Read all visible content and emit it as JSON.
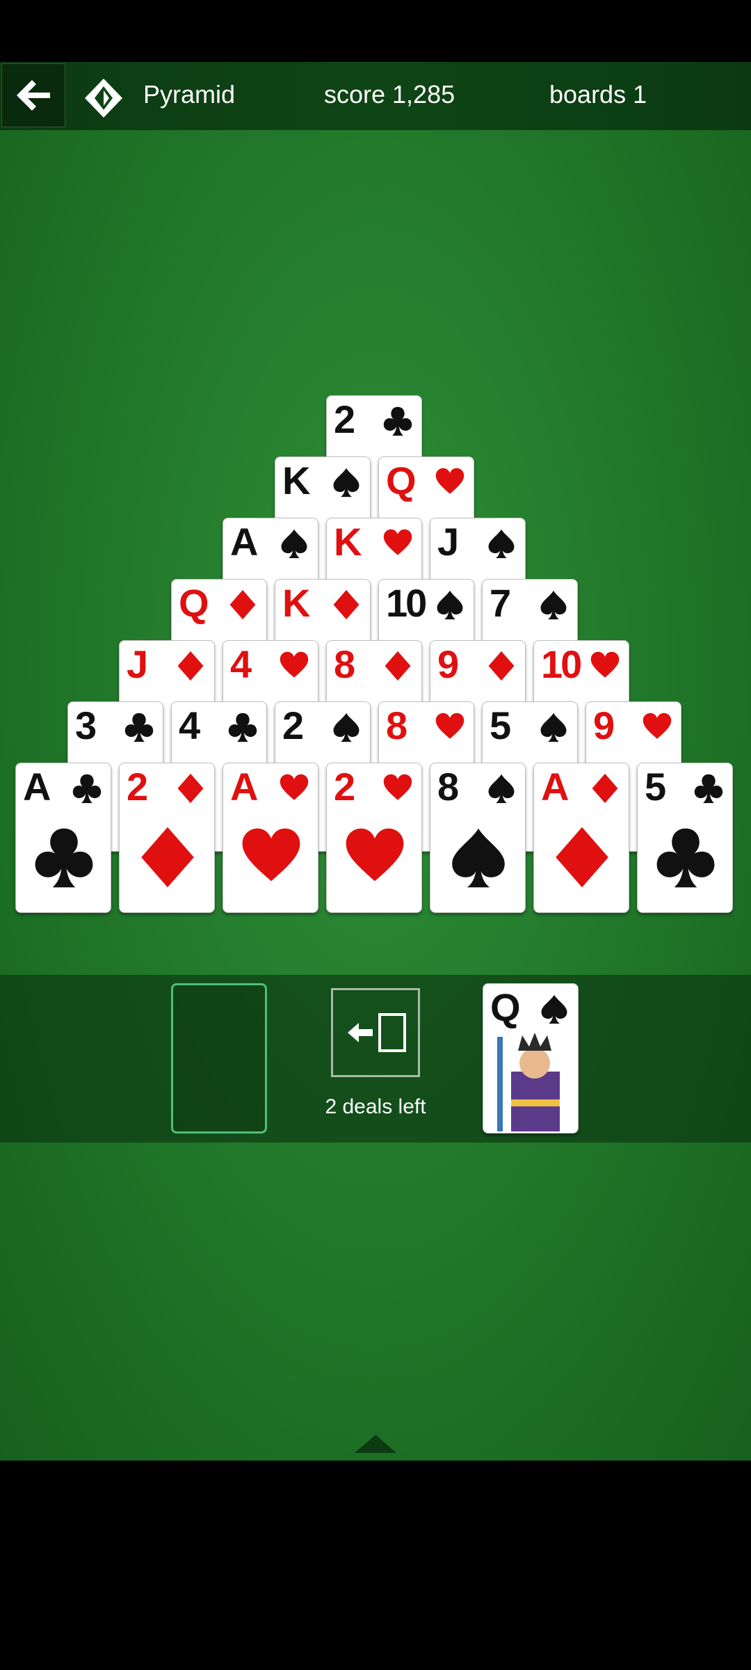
{
  "header": {
    "title": "Pyramid",
    "score": "score 1,285",
    "boards": "boards 1"
  },
  "deals": {
    "label": "2 deals left"
  },
  "colors": {
    "felt": "#237a2b",
    "header": "#0f4516",
    "red_suit": "#e01010",
    "black_suit": "#111111",
    "slot_border": "#4fbf7a"
  },
  "pyramid": [
    [
      {
        "rank": "2",
        "suit": "clubs"
      }
    ],
    [
      {
        "rank": "K",
        "suit": "spades"
      },
      {
        "rank": "Q",
        "suit": "hearts"
      }
    ],
    [
      {
        "rank": "A",
        "suit": "spades"
      },
      {
        "rank": "K",
        "suit": "hearts"
      },
      {
        "rank": "J",
        "suit": "spades"
      }
    ],
    [
      {
        "rank": "Q",
        "suit": "diamonds"
      },
      {
        "rank": "K",
        "suit": "diamonds"
      },
      {
        "rank": "10",
        "suit": "spades"
      },
      {
        "rank": "7",
        "suit": "spades"
      }
    ],
    [
      {
        "rank": "J",
        "suit": "diamonds"
      },
      {
        "rank": "4",
        "suit": "hearts"
      },
      {
        "rank": "8",
        "suit": "diamonds"
      },
      {
        "rank": "9",
        "suit": "diamonds"
      },
      {
        "rank": "10",
        "suit": "hearts"
      }
    ],
    [
      {
        "rank": "3",
        "suit": "clubs"
      },
      {
        "rank": "4",
        "suit": "clubs"
      },
      {
        "rank": "2",
        "suit": "spades"
      },
      {
        "rank": "8",
        "suit": "hearts"
      },
      {
        "rank": "5",
        "suit": "spades"
      },
      {
        "rank": "9",
        "suit": "hearts"
      }
    ],
    [
      {
        "rank": "A",
        "suit": "clubs"
      },
      {
        "rank": "2",
        "suit": "diamonds"
      },
      {
        "rank": "A",
        "suit": "hearts"
      },
      {
        "rank": "2",
        "suit": "hearts"
      },
      {
        "rank": "8",
        "suit": "spades"
      },
      {
        "rank": "A",
        "suit": "diamonds"
      },
      {
        "rank": "5",
        "suit": "clubs"
      }
    ]
  ],
  "waste": {
    "rank": "Q",
    "suit": "spades"
  },
  "icons": {
    "back": "arrow-left-icon",
    "game": "pyramid-game-icon",
    "recycle": "recycle-deck-icon",
    "expand": "chevron-up-icon"
  }
}
